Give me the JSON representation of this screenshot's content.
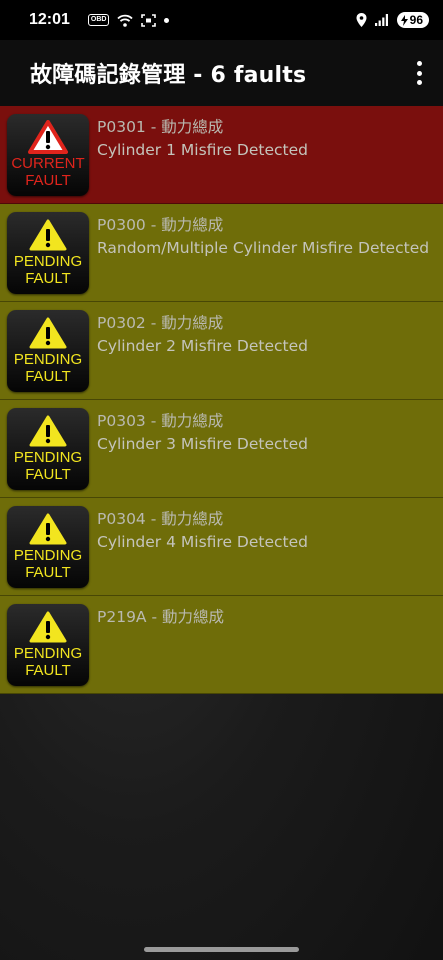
{
  "status_bar": {
    "time": "12:01",
    "obd_label": "OBD",
    "battery": "96",
    "icons": [
      "obd-icon",
      "wifi-icon",
      "screenshot-icon",
      "dot-icon",
      "location-icon",
      "signal-icon",
      "battery-icon"
    ]
  },
  "app_bar": {
    "title": "故障碼記錄管理 - 6 faults",
    "menu_icon": "more-vert-icon"
  },
  "faults": [
    {
      "type": "current",
      "badge_line1": "CURRENT",
      "badge_line2": "FAULT",
      "code": "P0301 - 動力總成",
      "description": "Cylinder 1 Misfire Detected"
    },
    {
      "type": "pending",
      "badge_line1": "PENDING",
      "badge_line2": "FAULT",
      "code": "P0300 - 動力總成",
      "description": "Random/Multiple Cylinder Misfire Detected"
    },
    {
      "type": "pending",
      "badge_line1": "PENDING",
      "badge_line2": "FAULT",
      "code": "P0302 - 動力總成",
      "description": "Cylinder 2 Misfire Detected"
    },
    {
      "type": "pending",
      "badge_line1": "PENDING",
      "badge_line2": "FAULT",
      "code": "P0303 - 動力總成",
      "description": "Cylinder 3 Misfire Detected"
    },
    {
      "type": "pending",
      "badge_line1": "PENDING",
      "badge_line2": "FAULT",
      "code": "P0304 - 動力總成",
      "description": "Cylinder 4 Misfire Detected"
    },
    {
      "type": "pending",
      "badge_line1": "PENDING",
      "badge_line2": "FAULT",
      "code": "P219A - 動力總成",
      "description": ""
    }
  ],
  "colors": {
    "current_row": "#7a0f0d",
    "pending_row": "#6f6d09",
    "current_text": "#e0241c",
    "pending_text": "#f2e51f"
  }
}
